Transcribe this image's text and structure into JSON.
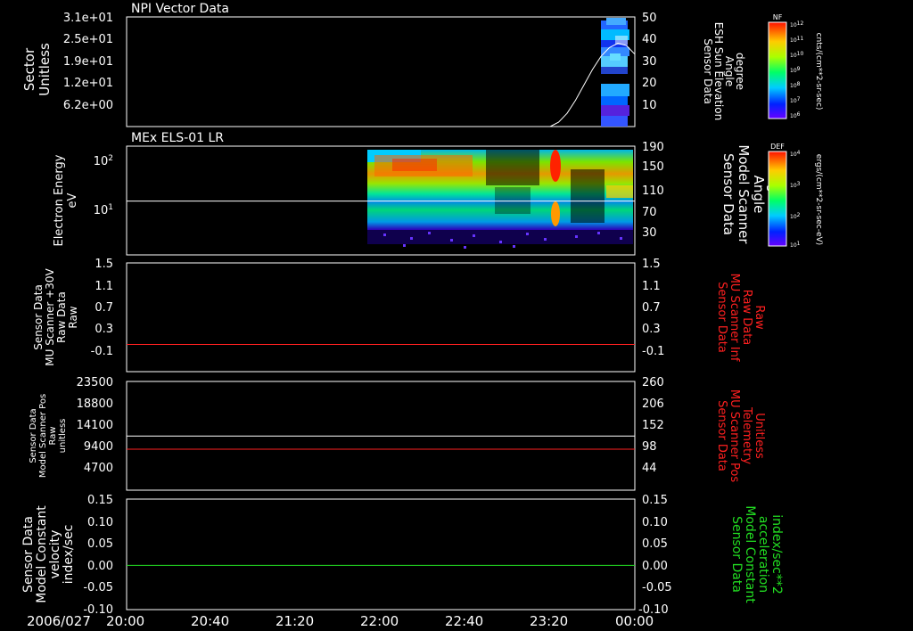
{
  "colors": {
    "background": "#000000",
    "white": "#ffffff",
    "red": "#ff2020",
    "green": "#22dd22"
  },
  "chart_data": [
    {
      "type": "heatmap",
      "title": "NPI Vector Data",
      "ylabel": [
        "Sector",
        "Unitless"
      ],
      "ylim": [
        0,
        31.0
      ],
      "ytick_labels": [
        "3.1e+01",
        "2.5e+01",
        "1.9e+01",
        "1.2e+01",
        "6.2e+00"
      ],
      "y2label": [
        "Sensor Data",
        "ESH Sun Elevation",
        "Angle",
        "degree"
      ],
      "y2lim": [
        0,
        50
      ],
      "y2tick_labels": [
        "50",
        "40",
        "30",
        "20",
        "10"
      ],
      "overlay_line": {
        "name": "ESH Sun Elevation Angle",
        "color": "#ffffff",
        "x": [
          "23:20",
          "23:24",
          "23:28",
          "23:32",
          "23:36",
          "23:40",
          "23:44",
          "23:48",
          "23:52",
          "23:56",
          "00:00"
        ],
        "y": [
          0,
          2,
          6,
          12,
          19,
          26,
          32,
          36,
          38,
          37,
          33
        ]
      },
      "colorbar": {
        "title": "NF",
        "label": "cnts/(cm**2-sr-sec)",
        "tick_labels": [
          "10^12",
          "10^11",
          "10^10",
          "10^9",
          "10^8",
          "10^7",
          "10^6"
        ]
      }
    },
    {
      "type": "heatmap",
      "title": "MEx ELS-01 LR",
      "ylabel": [
        "Electron Energy",
        "eV"
      ],
      "yscale": "log",
      "ytick_labels": [
        "10^2",
        "10^1"
      ],
      "y2label": [
        "Sensor Data",
        "Model Scanner",
        "Angle",
        "degrees"
      ],
      "y2lim": [
        0,
        190
      ],
      "y2tick_labels": [
        "190",
        "150",
        "110",
        "70",
        "30"
      ],
      "overlay_line": {
        "name": "Model Scanner Angle",
        "color": "#ffffff",
        "y": 94
      },
      "colorbar": {
        "title": "DEF",
        "label": "ergs/(cm**2-sr-sec-eV)",
        "tick_labels": [
          "10^4",
          "10^3",
          "10^2",
          "10^1"
        ]
      }
    },
    {
      "type": "line",
      "ylabel": [
        "Sensor Data",
        "MU Scanner +30V",
        "Raw Data",
        "Raw"
      ],
      "ylim": [
        -0.5,
        1.5
      ],
      "ytick_labels": [
        "1.5",
        "1.1",
        "0.7",
        "0.3",
        "-0.1"
      ],
      "y2label": [
        "Sensor Data",
        "MU Scanner Inf",
        "Raw Data",
        "Raw"
      ],
      "y2tick_labels": [
        "1.5",
        "1.1",
        "0.7",
        "0.3",
        "-0.1"
      ],
      "series": [
        {
          "color": "#ff2020",
          "y": 0.0
        }
      ]
    },
    {
      "type": "line",
      "ylabel": [
        "Sensor Data",
        "Model Scanner Pos",
        "Raw",
        "unitless"
      ],
      "ylim": [
        0,
        23500
      ],
      "ytick_labels": [
        "23500",
        "18800",
        "14100",
        "9400",
        "4700"
      ],
      "y2label": [
        "Sensor Data",
        "MU Scanner Pos",
        "Telemetry",
        "Unitless"
      ],
      "y2lim": [
        0,
        260
      ],
      "y2tick_labels": [
        "260",
        "206",
        "152",
        "98",
        "44"
      ],
      "series": [
        {
          "color": "#ffffff",
          "y": 11700
        },
        {
          "color": "#ff2020",
          "y": 8850
        }
      ]
    },
    {
      "type": "line",
      "ylabel": [
        "Sensor Data",
        "Model Constant",
        "velocity",
        "index/sec"
      ],
      "ylim": [
        -0.1,
        0.15
      ],
      "ytick_labels": [
        "0.15",
        "0.10",
        "0.05",
        "0.00",
        "-0.05",
        "-0.10"
      ],
      "y2label": [
        "Sensor Data",
        "Model Constant",
        "acceleration",
        "index/sec**2"
      ],
      "y2tick_labels": [
        "0.15",
        "0.10",
        "0.05",
        "0.00",
        "-0.05",
        "-0.10"
      ],
      "series": [
        {
          "color": "#22dd22",
          "y": 0.0
        }
      ]
    }
  ],
  "x_axis": {
    "date_label": "2006/027",
    "tick_labels": [
      "20:00",
      "20:40",
      "21:20",
      "22:00",
      "22:40",
      "23:20",
      "00:00"
    ]
  }
}
